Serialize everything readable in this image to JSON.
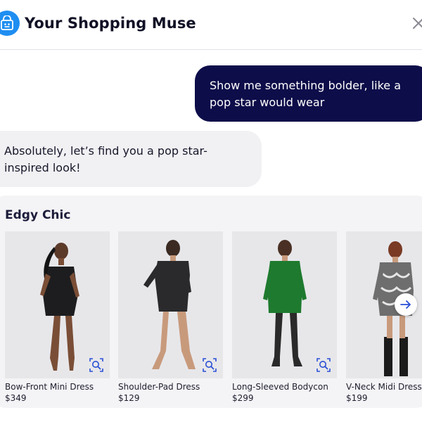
{
  "header": {
    "title": "Your Shopping Muse"
  },
  "chat": {
    "user_message": "Show me something bolder, like a pop star would wear",
    "bot_message": "Absolutely, let’s find you a pop star-inspired look!"
  },
  "results": {
    "section_title": "Edgy Chic",
    "products": [
      {
        "name": "Bow-Front Mini Dress",
        "price": "$349",
        "dress_color": "#1d1d1f"
      },
      {
        "name": "Shoulder-Pad Dress",
        "price": "$129",
        "dress_color": "#2a2a2d"
      },
      {
        "name": "Long-Sleeved Bodycon",
        "price": "$299",
        "dress_color": "#1e7a2e"
      },
      {
        "name": "V-Neck Midi Dress",
        "price": "$199",
        "dress_color": "#6e6e6e"
      }
    ]
  },
  "colors": {
    "accent_blue": "#1f8ef1",
    "user_bubble": "#0d0d4a",
    "lens_icon": "#2a4fd6"
  }
}
